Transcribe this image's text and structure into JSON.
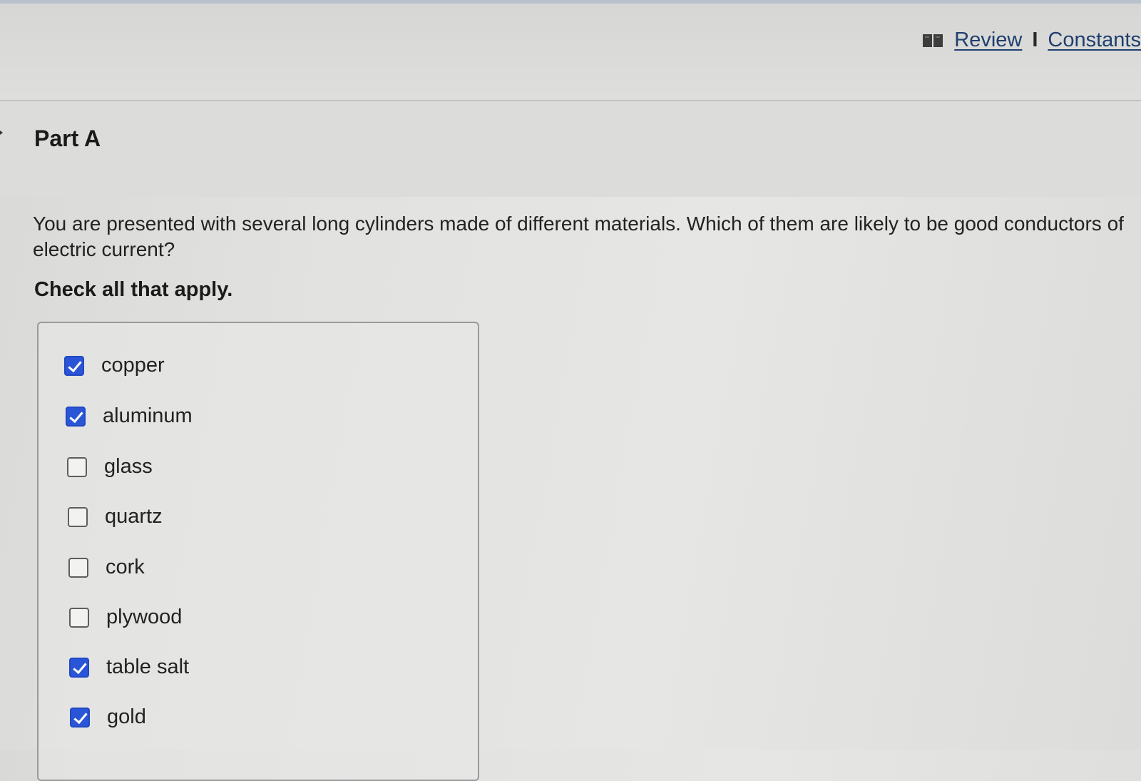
{
  "header": {
    "review_label": "Review",
    "separator": "I",
    "constants_label": "Constants",
    "icon": "book-icon"
  },
  "part": {
    "title": "Part A"
  },
  "question": {
    "text": "You are presented with several long cylinders made of different materials. Which of them are likely to be good conductors of electric current?",
    "instruction": "Check all that apply."
  },
  "options": [
    {
      "label": "copper",
      "checked": true
    },
    {
      "label": "aluminum",
      "checked": true
    },
    {
      "label": "glass",
      "checked": false
    },
    {
      "label": "quartz",
      "checked": false
    },
    {
      "label": "cork",
      "checked": false
    },
    {
      "label": "plywood",
      "checked": false
    },
    {
      "label": "table salt",
      "checked": true
    },
    {
      "label": "gold",
      "checked": true
    }
  ],
  "colors": {
    "checkbox_checked": "#2a55d6",
    "link": "#1f3f6e"
  }
}
